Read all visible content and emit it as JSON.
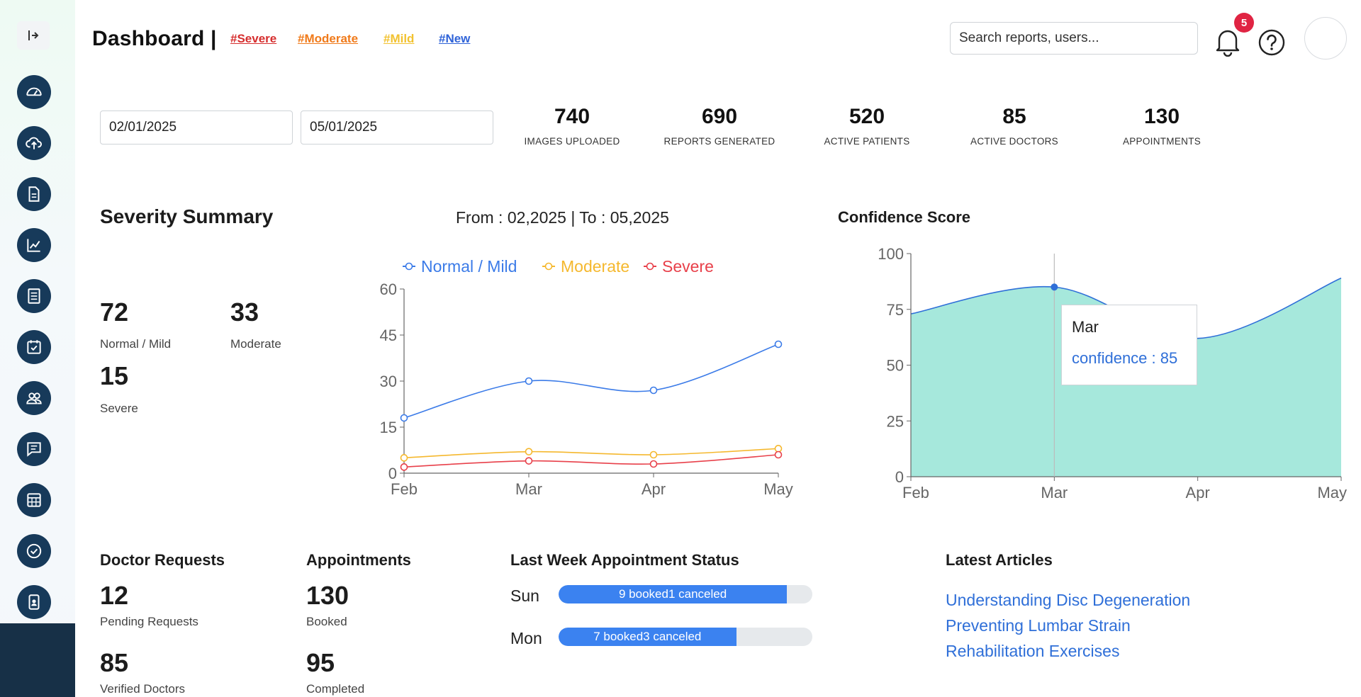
{
  "header": {
    "title": "Dashboard |",
    "tags": [
      {
        "label": "#Severe",
        "color": "#d62e2e"
      },
      {
        "label": "#Moderate",
        "color": "#f07a1a"
      },
      {
        "label": "#Mild",
        "color": "#f2c230"
      },
      {
        "label": "#New",
        "color": "#2f63d8"
      }
    ],
    "search_placeholder": "Search reports, users...",
    "notification_count": "5"
  },
  "sidebar": {
    "items": [
      {
        "icon": "gauge-icon"
      },
      {
        "icon": "cloud-upload-icon"
      },
      {
        "icon": "document-icon"
      },
      {
        "icon": "line-chart-icon"
      },
      {
        "icon": "report-list-icon"
      },
      {
        "icon": "calendar-check-icon"
      },
      {
        "icon": "users-icon"
      },
      {
        "icon": "message-icon"
      },
      {
        "icon": "calculator-icon"
      },
      {
        "icon": "check-circle-icon"
      },
      {
        "icon": "id-badge-icon"
      }
    ]
  },
  "filters": {
    "start_date": "02/01/2025",
    "end_date": "05/01/2025"
  },
  "stats": [
    {
      "value": "740",
      "label": "IMAGES UPLOADED"
    },
    {
      "value": "690",
      "label": "REPORTS GENERATED"
    },
    {
      "value": "520",
      "label": "ACTIVE PATIENTS"
    },
    {
      "value": "85",
      "label": "ACTIVE DOCTORS"
    },
    {
      "value": "130",
      "label": "APPOINTMENTS"
    }
  ],
  "severity_summary": {
    "title": "Severity Summary",
    "range_text": "From : 02,2025 | To : 05,2025",
    "normal_mild": {
      "value": "72",
      "label": "Normal / Mild"
    },
    "moderate": {
      "value": "33",
      "label": "Moderate"
    },
    "severe": {
      "value": "15",
      "label": "Severe"
    }
  },
  "confidence": {
    "title": "Confidence Score",
    "tooltip_title": "Mar",
    "tooltip_value": "confidence : 85"
  },
  "chart_data": [
    {
      "type": "line",
      "title": "",
      "x": [
        "Feb",
        "Mar",
        "Apr",
        "May"
      ],
      "ylim": [
        0,
        60
      ],
      "yticks": [
        0,
        15,
        30,
        45,
        60
      ],
      "legend_position": "top-center",
      "series": [
        {
          "name": "Normal / Mild",
          "values": [
            18,
            30,
            27,
            42
          ],
          "color": "#3b7be8"
        },
        {
          "name": "Moderate",
          "values": [
            5,
            7,
            6,
            8
          ],
          "color": "#f5b82e"
        },
        {
          "name": "Severe",
          "values": [
            2,
            4,
            3,
            6
          ],
          "color": "#e8404a"
        }
      ]
    },
    {
      "type": "area",
      "title": "Confidence Score",
      "x": [
        "Feb",
        "Mar",
        "Apr",
        "May"
      ],
      "ylim": [
        0,
        100
      ],
      "yticks": [
        0,
        25,
        50,
        75,
        100
      ],
      "series": [
        {
          "name": "confidence",
          "values": [
            73,
            85,
            62,
            89
          ],
          "color": "#2f6fd8",
          "fill": "#a6e8dc"
        }
      ]
    }
  ],
  "doctor_requests": {
    "title": "Doctor Requests",
    "pending": {
      "value": "12",
      "label": "Pending Requests"
    },
    "verified": {
      "value": "85",
      "label": "Verified Doctors"
    }
  },
  "appointments": {
    "title": "Appointments",
    "booked": {
      "value": "130",
      "label": "Booked"
    },
    "completed": {
      "value": "95",
      "label": "Completed"
    }
  },
  "week_status": {
    "title": "Last Week Appointment Status",
    "days": [
      {
        "day": "Sun",
        "text": "9 booked1 canceled",
        "fill": 0.9
      },
      {
        "day": "Mon",
        "text": "7 booked3 canceled",
        "fill": 0.7
      }
    ]
  },
  "articles": {
    "title": "Latest Articles",
    "items": [
      "Understanding Disc Degeneration",
      "Preventing Lumbar Strain",
      "Rehabilitation Exercises"
    ]
  }
}
